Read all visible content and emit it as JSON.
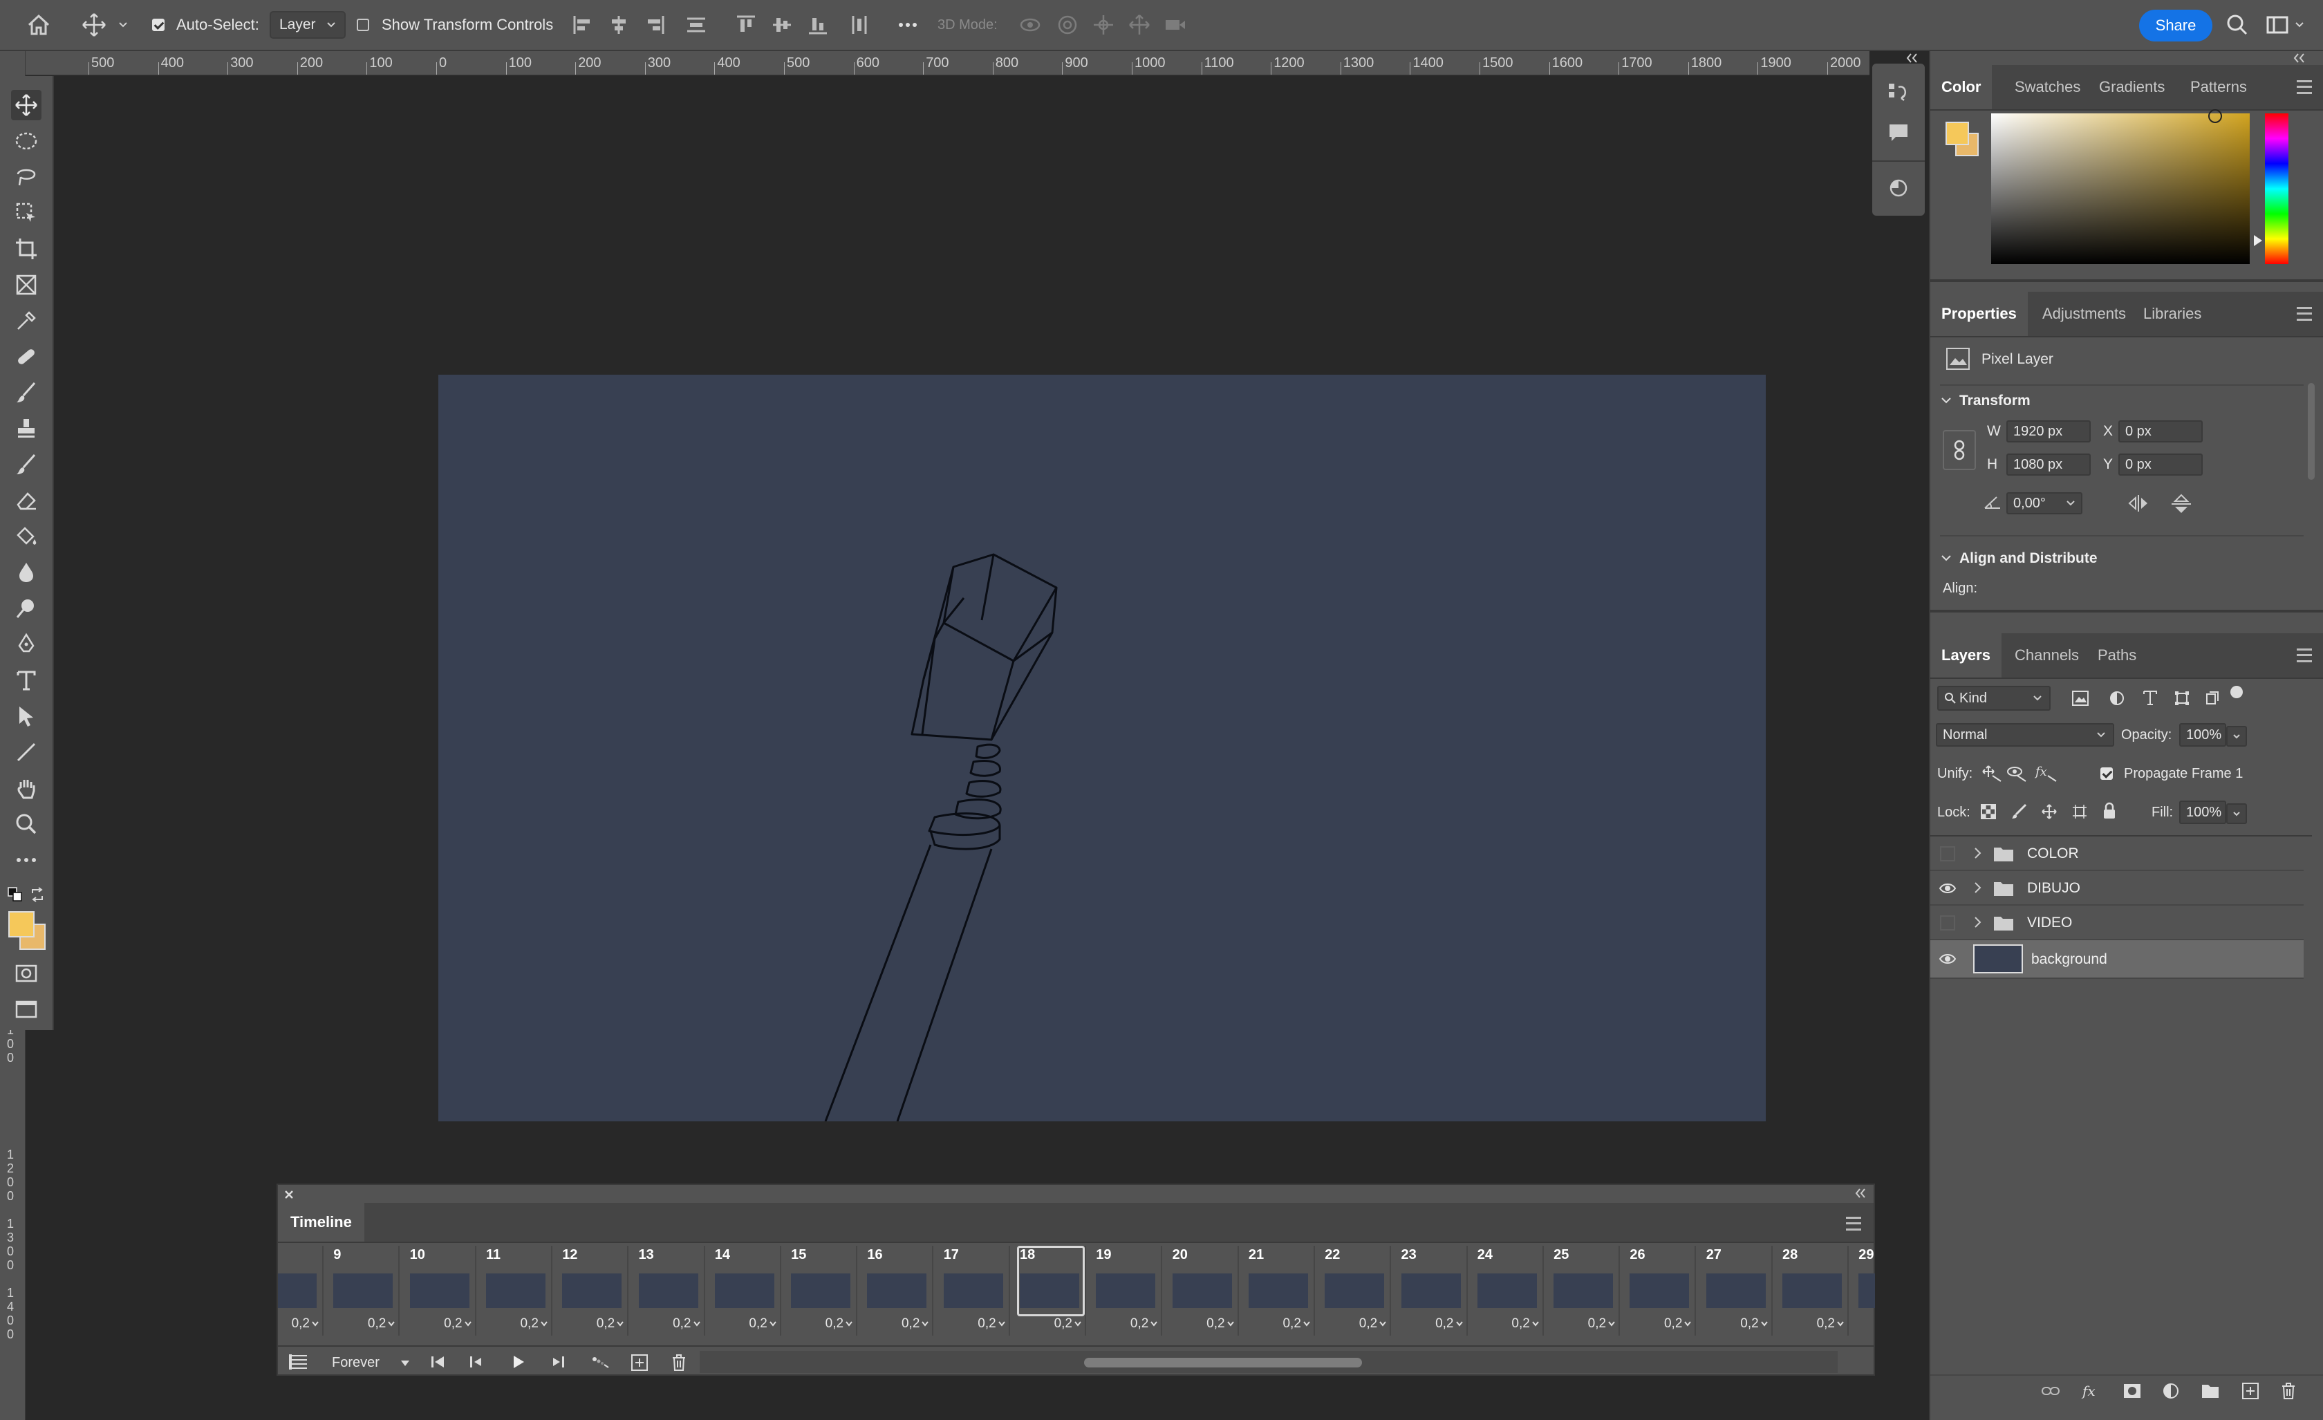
{
  "option_bar": {
    "auto_select_label": "Auto-Select:",
    "auto_select_checked": true,
    "auto_select_value": "Layer",
    "show_transform_label": "Show Transform Controls",
    "show_transform_checked": false,
    "mode_3d_label": "3D Mode:",
    "share_label": "Share"
  },
  "ruler": {
    "h_ticks": [
      "500",
      "400",
      "300",
      "200",
      "100",
      "0",
      "100",
      "200",
      "300",
      "400",
      "500",
      "600",
      "700",
      "800",
      "900",
      "1000",
      "1100",
      "1200",
      "1300",
      "1400",
      "1500",
      "1600",
      "1700",
      "1800",
      "1900",
      "2000"
    ],
    "v_ticks": [
      "1",
      "0",
      "0",
      "1",
      "2",
      "0",
      "0",
      "1",
      "3",
      "0",
      "0",
      "1",
      "4",
      "0",
      "0"
    ]
  },
  "colors": {
    "foreground": "#f5c85a",
    "background": "#e8b86a",
    "canvas_bg": "#384052",
    "accent": "#1473e6"
  },
  "color_panel": {
    "tabs": [
      "Color",
      "Swatches",
      "Gradients",
      "Patterns"
    ],
    "active_tab": "Color"
  },
  "properties_panel": {
    "tabs": [
      "Properties",
      "Adjustments",
      "Libraries"
    ],
    "layer_type": "Pixel Layer",
    "transform_title": "Transform",
    "w_label": "W",
    "w_value": "1920 px",
    "h_label": "H",
    "h_value": "1080 px",
    "x_label": "X",
    "x_value": "0 px",
    "y_label": "Y",
    "y_value": "0 px",
    "angle_value": "0,00°",
    "align_title": "Align and Distribute",
    "align_label": "Align:"
  },
  "layers_panel": {
    "tabs": [
      "Layers",
      "Channels",
      "Paths"
    ],
    "filter_value": "Kind",
    "blend_mode": "Normal",
    "opacity_label": "Opacity:",
    "opacity_value": "100%",
    "unify_label": "Unify:",
    "propagate_label": "Propagate Frame 1",
    "lock_label": "Lock:",
    "fill_label": "Fill:",
    "fill_value": "100%",
    "layers": [
      {
        "name": "COLOR",
        "type": "group",
        "visible": false
      },
      {
        "name": "DIBUJO",
        "type": "group",
        "visible": true
      },
      {
        "name": "VIDEO",
        "type": "group",
        "visible": false
      },
      {
        "name": "background",
        "type": "pixel",
        "visible": true,
        "selected": true
      }
    ]
  },
  "timeline": {
    "title": "Timeline",
    "loop_value": "Forever",
    "frames": [
      {
        "num": "",
        "dur": "0,2"
      },
      {
        "num": "9",
        "dur": "0,2"
      },
      {
        "num": "10",
        "dur": "0,2"
      },
      {
        "num": "11",
        "dur": "0,2"
      },
      {
        "num": "12",
        "dur": "0,2"
      },
      {
        "num": "13",
        "dur": "0,2"
      },
      {
        "num": "14",
        "dur": "0,2"
      },
      {
        "num": "15",
        "dur": "0,2"
      },
      {
        "num": "16",
        "dur": "0,2"
      },
      {
        "num": "17",
        "dur": "0,2"
      },
      {
        "num": "18",
        "dur": "0,2",
        "selected": true
      },
      {
        "num": "19",
        "dur": "0,2"
      },
      {
        "num": "20",
        "dur": "0,2"
      },
      {
        "num": "21",
        "dur": "0,2"
      },
      {
        "num": "22",
        "dur": "0,2"
      },
      {
        "num": "23",
        "dur": "0,2"
      },
      {
        "num": "24",
        "dur": "0,2"
      },
      {
        "num": "25",
        "dur": "0,2"
      },
      {
        "num": "26",
        "dur": "0,2"
      },
      {
        "num": "27",
        "dur": "0,2"
      },
      {
        "num": "28",
        "dur": "0,2"
      },
      {
        "num": "29",
        "dur": ""
      }
    ]
  }
}
